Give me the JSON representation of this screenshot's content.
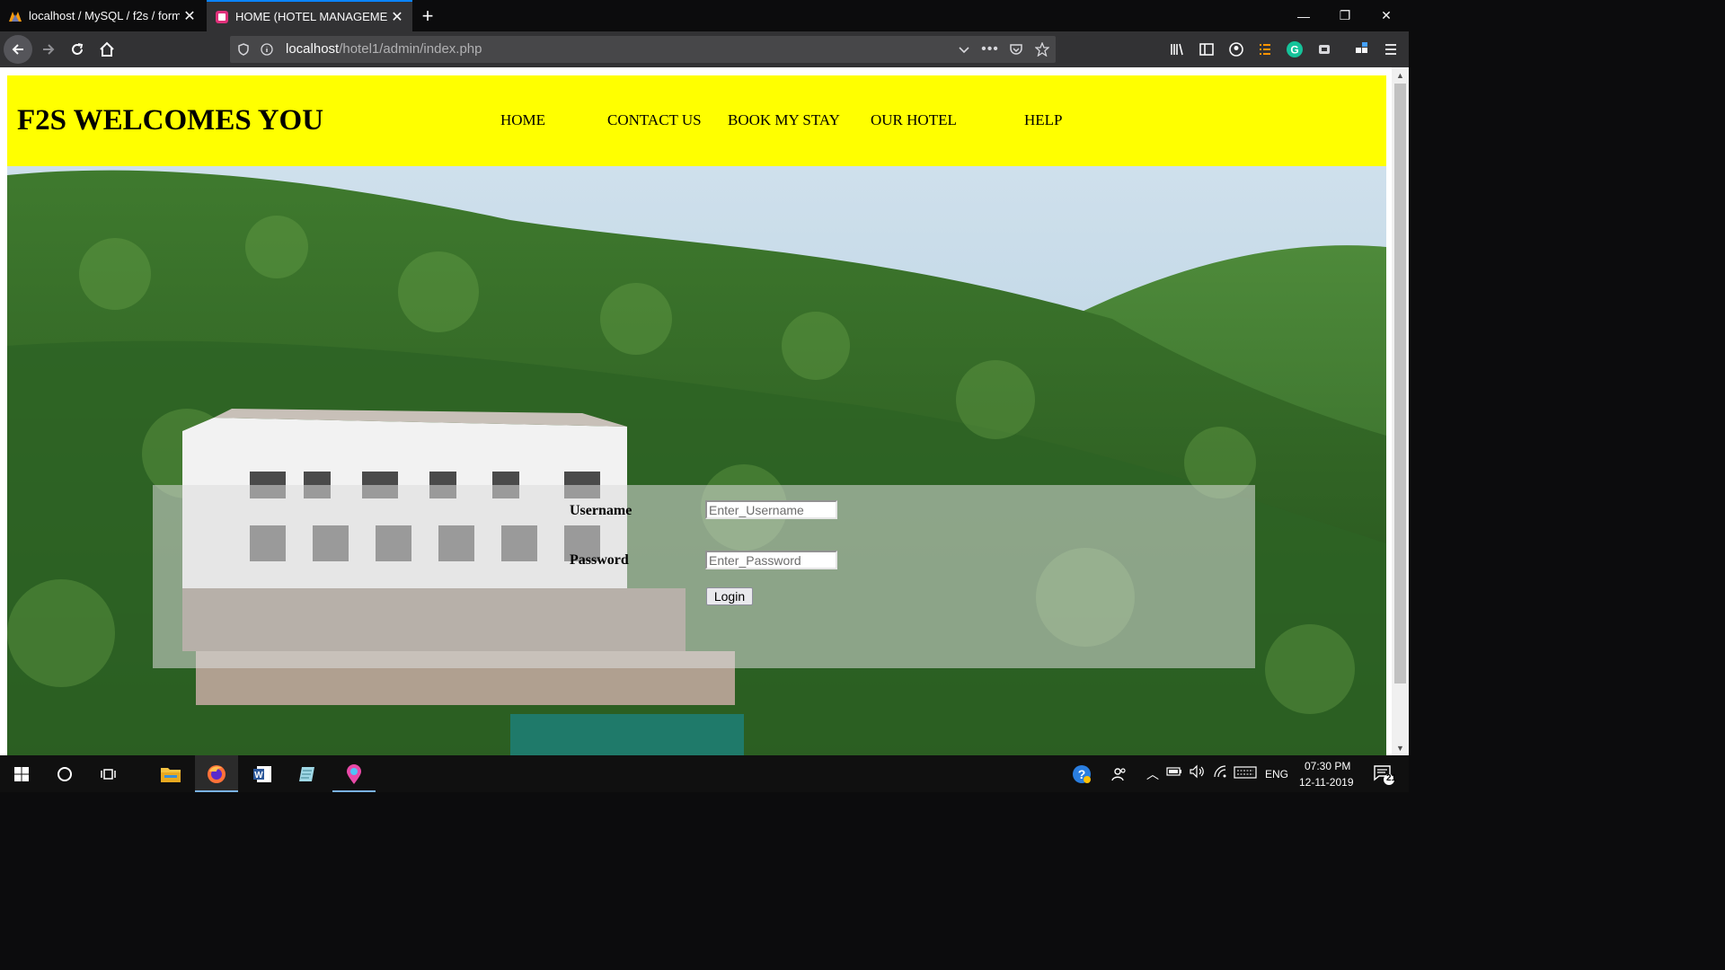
{
  "browser": {
    "tabs": [
      {
        "title": "localhost / MySQL / f2s / form",
        "active": false,
        "icon": "phpmyadmin-icon"
      },
      {
        "title": "HOME (HOTEL MANAGEMENT)",
        "active": true,
        "icon": "page-favicon-icon"
      }
    ],
    "url": {
      "host": "localhost",
      "path": "/hotel1/admin/index.php"
    }
  },
  "site": {
    "title": "F2S WELCOMES YOU",
    "nav": [
      "HOME",
      "CONTACT US",
      "BOOK MY STAY",
      "OUR HOTEL",
      "HELP"
    ],
    "header_color": "#ffff00"
  },
  "login": {
    "username_label": "Username",
    "username_placeholder": "Enter_Username",
    "password_label": "Password",
    "password_placeholder": "Enter_Password",
    "button_label": "Login"
  },
  "taskbar": {
    "language": "ENG",
    "time": "07:30 PM",
    "date": "12-11-2019",
    "notifications": "21"
  }
}
